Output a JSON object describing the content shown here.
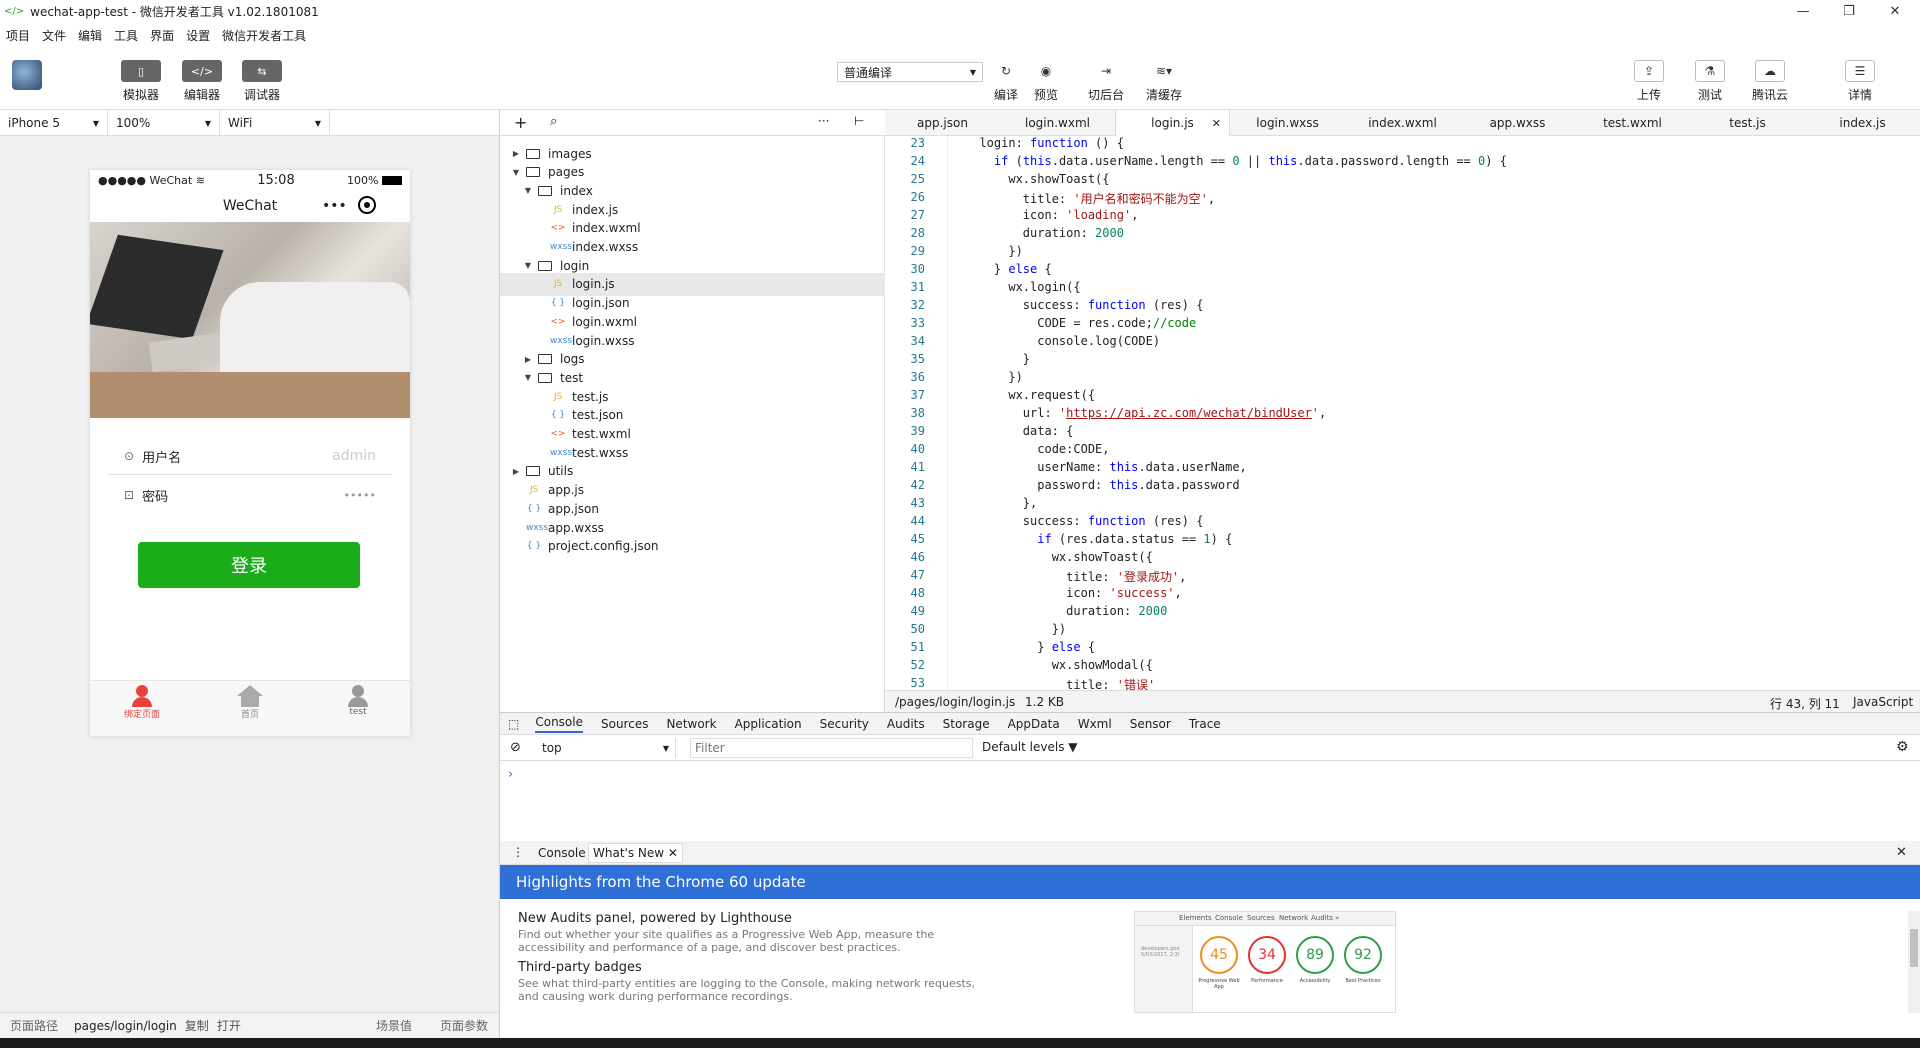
{
  "window": {
    "title": "wechat-app-test - 微信开发者工具 v1.02.1801081"
  },
  "menu": [
    "项目",
    "文件",
    "编辑",
    "工具",
    "界面",
    "设置",
    "微信开发者工具"
  ],
  "toolbar": {
    "left": [
      {
        "label": "模拟器"
      },
      {
        "label": "编辑器"
      },
      {
        "label": "调试器"
      }
    ],
    "compile_mode": "普通编译",
    "center": [
      {
        "label": "编译"
      },
      {
        "label": "预览"
      },
      {
        "label": "切后台"
      },
      {
        "label": "清缓存"
      }
    ],
    "right": [
      {
        "label": "上传"
      },
      {
        "label": "测试"
      },
      {
        "label": "腾讯云"
      },
      {
        "label": "详情"
      }
    ]
  },
  "device_bar": {
    "device": "iPhone 5",
    "zoom": "100%",
    "network": "WiFi"
  },
  "phone": {
    "carrier": "●●●●● WeChat",
    "time": "15:08",
    "battery": "100%",
    "nav_title": "WeChat",
    "username_label": "用户名",
    "username_placeholder": "admin",
    "password_label": "密码",
    "password_value": "•••••",
    "login_button": "登录",
    "tabbar": [
      {
        "label": "绑定页面",
        "active": true
      },
      {
        "label": "首页",
        "active": false
      },
      {
        "label": "test",
        "active": false
      }
    ],
    "accent": "#1aad19"
  },
  "status_bottom": {
    "path_label": "页面路径",
    "path": "pages/login/login",
    "copy": "复制",
    "open": "打开",
    "scene": "场景值",
    "params": "页面参数"
  },
  "files": [
    {
      "name": "images",
      "type": "folder",
      "depth": 0,
      "open": false
    },
    {
      "name": "pages",
      "type": "folder",
      "depth": 0,
      "open": true
    },
    {
      "name": "index",
      "type": "folder",
      "depth": 1,
      "open": true
    },
    {
      "name": "index.js",
      "type": "js",
      "depth": 2
    },
    {
      "name": "index.wxml",
      "type": "wxml",
      "depth": 2
    },
    {
      "name": "index.wxss",
      "type": "wxss",
      "depth": 2
    },
    {
      "name": "login",
      "type": "folder",
      "depth": 1,
      "open": true
    },
    {
      "name": "login.js",
      "type": "js",
      "depth": 2,
      "selected": true
    },
    {
      "name": "login.json",
      "type": "json",
      "depth": 2
    },
    {
      "name": "login.wxml",
      "type": "wxml",
      "depth": 2
    },
    {
      "name": "login.wxss",
      "type": "wxss",
      "depth": 2
    },
    {
      "name": "logs",
      "type": "folder",
      "depth": 1,
      "open": false
    },
    {
      "name": "test",
      "type": "folder",
      "depth": 1,
      "open": true
    },
    {
      "name": "test.js",
      "type": "js",
      "depth": 2
    },
    {
      "name": "test.json",
      "type": "json",
      "depth": 2
    },
    {
      "name": "test.wxml",
      "type": "wxml",
      "depth": 2
    },
    {
      "name": "test.wxss",
      "type": "wxss",
      "depth": 2
    },
    {
      "name": "utils",
      "type": "folder",
      "depth": 0,
      "open": false
    },
    {
      "name": "app.js",
      "type": "js",
      "depth": 0
    },
    {
      "name": "app.json",
      "type": "json",
      "depth": 0
    },
    {
      "name": "app.wxss",
      "type": "wxss",
      "depth": 0
    },
    {
      "name": "project.config.json",
      "type": "json",
      "depth": 0
    }
  ],
  "file_icons": {
    "js": "JS",
    "json": "{ }",
    "wxml": "<>",
    "wxss": "wxss"
  },
  "tabs": [
    "app.json",
    "login.wxml",
    "login.js",
    "login.wxss",
    "index.wxml",
    "app.wxss",
    "test.wxml",
    "test.js",
    "index.js"
  ],
  "active_tab": "login.js",
  "code": [
    {
      "n": "23",
      "html": "  login: <span class=\"kw\">function</span> () {"
    },
    {
      "n": "24",
      "html": "    <span class=\"kw\">if</span> (<span class=\"kw\">this</span>.data.userName.length == <span class=\"num\">0</span> || <span class=\"kw\">this</span>.data.password.length == <span class=\"num\">0</span>) {"
    },
    {
      "n": "25",
      "html": "      wx.showToast({"
    },
    {
      "n": "26",
      "html": "        title: <span class=\"str\">'用户名和密码不能为空'</span>,"
    },
    {
      "n": "27",
      "html": "        icon: <span class=\"str\">'loading'</span>,"
    },
    {
      "n": "28",
      "html": "        duration: <span class=\"num\">2000</span>"
    },
    {
      "n": "29",
      "html": "      })"
    },
    {
      "n": "30",
      "html": "    } <span class=\"kw\">else</span> {"
    },
    {
      "n": "31",
      "html": "      wx.login({"
    },
    {
      "n": "32",
      "html": "        success: <span class=\"kw\">function</span> (res) {"
    },
    {
      "n": "33",
      "html": "          CODE = res.code;<span class=\"cm\">//code</span>"
    },
    {
      "n": "34",
      "html": "          console.log(CODE)"
    },
    {
      "n": "35",
      "html": "        }"
    },
    {
      "n": "36",
      "html": "      })"
    },
    {
      "n": "37",
      "html": "      wx.request({"
    },
    {
      "n": "38",
      "html": "        url: <span class=\"str\">'</span><span class=\"url\">https://api.zc.com/wechat/bindUser</span><span class=\"str\">'</span>,"
    },
    {
      "n": "39",
      "html": "        data: {"
    },
    {
      "n": "40",
      "html": "          code:CODE,"
    },
    {
      "n": "41",
      "html": "          userName: <span class=\"kw\">this</span>.data.userName,"
    },
    {
      "n": "42",
      "html": "          password: <span class=\"kw\">this</span>.data.password"
    },
    {
      "n": "43",
      "html": "        },"
    },
    {
      "n": "44",
      "html": "        success: <span class=\"kw\">function</span> (res) {"
    },
    {
      "n": "45",
      "html": "          <span class=\"kw\">if</span> (res.data.status == <span class=\"num\">1</span>) {"
    },
    {
      "n": "46",
      "html": "            wx.showToast({"
    },
    {
      "n": "47",
      "html": "              title: <span class=\"str\">'登录成功'</span>,"
    },
    {
      "n": "48",
      "html": "              icon: <span class=\"str\">'success'</span>,"
    },
    {
      "n": "49",
      "html": "              duration: <span class=\"num\">2000</span>"
    },
    {
      "n": "50",
      "html": "            })"
    },
    {
      "n": "51",
      "html": "          } <span class=\"kw\">else</span> {"
    },
    {
      "n": "52",
      "html": "            wx.showModal({"
    },
    {
      "n": "53",
      "html": "              title: <span class=\"str\">'错误'</span>"
    }
  ],
  "editor_status": {
    "path": "/pages/login/login.js",
    "size": "1.2 KB",
    "cursor": "行 43, 列 11",
    "lang": "JavaScript"
  },
  "devtools": {
    "tabs": [
      "Console",
      "Sources",
      "Network",
      "Application",
      "Security",
      "Audits",
      "Storage",
      "AppData",
      "Wxml",
      "Sensor",
      "Trace"
    ],
    "context": "top",
    "filter_placeholder": "Filter",
    "levels": "Default levels ▼",
    "drawer_tabs": [
      "Console",
      "What's New"
    ],
    "banner": "Highlights from the Chrome 60 update",
    "items": [
      {
        "title": "New Audits panel, powered by Lighthouse",
        "desc": "Find out whether your site qualifies as a Progressive Web App, measure the accessibility and performance of a page, and discover best practices."
      },
      {
        "title": "Third-party badges",
        "desc": "See what third-party entities are logging to the Console, making network requests, and causing work during performance recordings."
      }
    ],
    "preview_tabs": [
      "Elements",
      "Console",
      "Sources",
      "Network",
      "Audits",
      "»"
    ],
    "preview_side": [
      "developers.goo",
      "5/03/2017, 2:3("
    ],
    "scores": [
      {
        "value": 45,
        "label": "Progressive Web App",
        "color": "#f28b1d"
      },
      {
        "value": 34,
        "label": "Performance",
        "color": "#e0332e"
      },
      {
        "value": 89,
        "label": "Accessibility",
        "color": "#2e9e44"
      },
      {
        "value": 92,
        "label": "Best Practices",
        "color": "#2e9e44"
      }
    ]
  }
}
